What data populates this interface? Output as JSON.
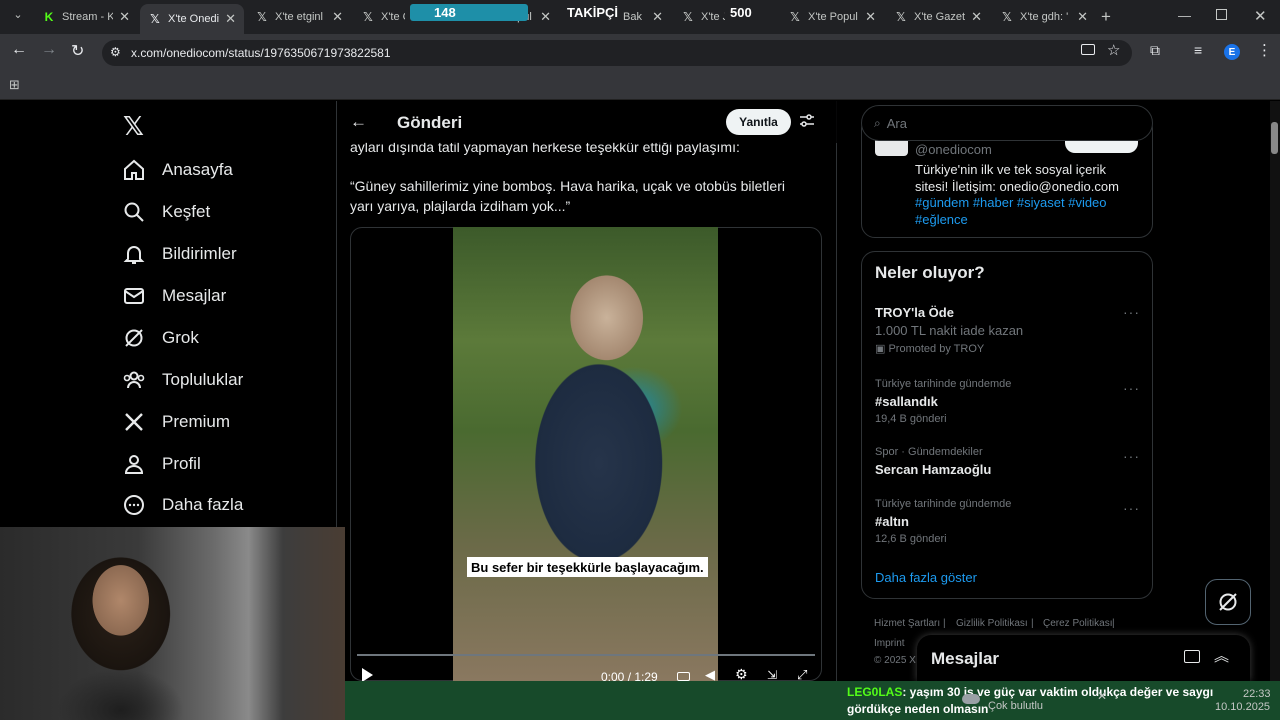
{
  "browser": {
    "tabs": [
      {
        "label": "Stream - K",
        "icon": "kick-icon"
      },
      {
        "label": "X'te Onedi",
        "icon": "x-logo-icon",
        "active": true
      },
      {
        "label": "X'te etginl",
        "icon": "x-logo-icon"
      },
      {
        "label": "X'te Çol",
        "icon": "x-logo-icon"
      },
      {
        "label": "opul",
        "icon": "x-logo-icon"
      },
      {
        "label": "Bak",
        "icon": "x-logo-icon"
      },
      {
        "label": "X'te Ju",
        "icon": "x-logo-icon"
      },
      {
        "label": "X'te Popul",
        "icon": "x-logo-icon"
      },
      {
        "label": "X'te Gazet",
        "icon": "x-logo-icon"
      },
      {
        "label": "X'te gdh: '",
        "icon": "x-logo-icon"
      }
    ],
    "url": "x.com/onediocom/status/1976350671973822581",
    "profile_initial": "E"
  },
  "overlay": {
    "counter_left": "148",
    "follower_label": "TAKİPÇİ",
    "counter_right": "500"
  },
  "nav": {
    "items": [
      {
        "label": "Anasayfa",
        "icon": "home-icon"
      },
      {
        "label": "Keşfet",
        "icon": "search-icon"
      },
      {
        "label": "Bildirimler",
        "icon": "bell-icon"
      },
      {
        "label": "Mesajlar",
        "icon": "mail-icon"
      },
      {
        "label": "Grok",
        "icon": "grok-icon"
      },
      {
        "label": "Topluluklar",
        "icon": "communities-icon"
      },
      {
        "label": "Premium",
        "icon": "x-logo-icon"
      },
      {
        "label": "Profil",
        "icon": "person-icon"
      },
      {
        "label": "Daha fazla",
        "icon": "more-circle-icon"
      }
    ]
  },
  "post": {
    "header_title": "Gönderi",
    "reply_label": "Yanıtla",
    "text_line1": "ayları dışında tatil yapmayan herkese teşekkür ettiği paylaşımı:",
    "text_quote_1": "“Güney sahillerimiz yine bomboş. Hava harika, uçak ve otobüs biletleri",
    "text_quote_2": "yarı yarıya, plajlarda izdiham yok...”",
    "subtitle": "Bu sefer bir teşekkürle başlayacağım.",
    "time": "0:00 / 1:29"
  },
  "sidebar": {
    "search_placeholder": "Ara",
    "profile_handle": "@onediocom",
    "bio_line1": "Türkiye'nin ilk ve tek sosyal içerik",
    "bio_line2": "sitesi! İletişim: onedio@onedio.com",
    "bio_tags1": "#gündem #haber #siyaset #video",
    "bio_tags2": "#eğlence",
    "trends_title": "Neler oluyor?",
    "trends": [
      {
        "title": "TROY'la Öde",
        "sub": "1.000 TL nakit iade kazan",
        "promo": "Promoted by TROY"
      },
      {
        "meta": "Türkiye tarihinde gündemde",
        "title": "#sallandık",
        "count": "19,4 B gönderi"
      },
      {
        "meta": "Spor · Gündemdekiler",
        "title": "Sercan Hamzaoğlu"
      },
      {
        "meta": "Türkiye tarihinde gündemde",
        "title": "#altın",
        "count": "12,6 B gönderi"
      }
    ],
    "show_more": "Daha fazla göster",
    "footer": [
      "Hizmet Şartları",
      "Gizlilik Politikası",
      "Çerez Politikası",
      "Imprint",
      "© 2025 X"
    ]
  },
  "messages": {
    "title": "Mesajlar"
  },
  "chat": {
    "user": "LEG0LAS",
    "message": ": yaşım 30 iş ve güç var vaktim oldukça değer ve saygı gördükçe neden olmasın"
  },
  "taskbar": {
    "weather": "Çok bulutlu",
    "time": "22:33",
    "date": "10.10.2025"
  },
  "colors": {
    "accent": "#1d9bf0",
    "bg": "#000000",
    "chat_bg": "#174a2a",
    "tab_bg": "#202124"
  }
}
